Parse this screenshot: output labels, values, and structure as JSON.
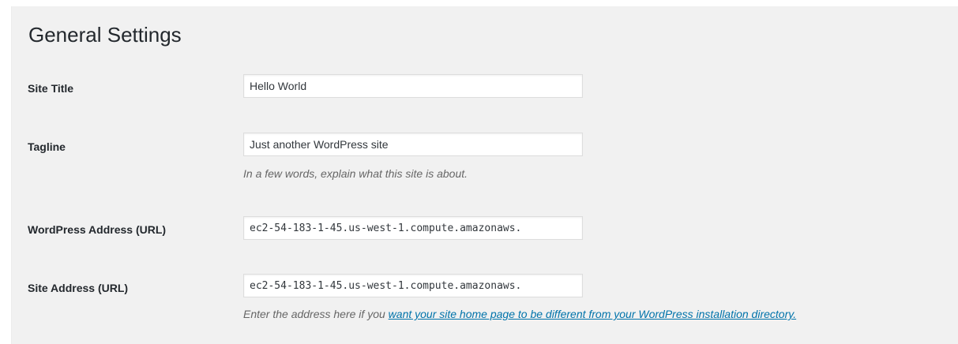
{
  "page": {
    "title": "General Settings"
  },
  "fields": {
    "site_title": {
      "label": "Site Title",
      "value": "Hello World"
    },
    "tagline": {
      "label": "Tagline",
      "value": "Just another WordPress site",
      "description": "In a few words, explain what this site is about."
    },
    "wordpress_address": {
      "label": "WordPress Address (URL)",
      "value": "ec2-54-183-1-45.us-west-1.compute.amazonaws."
    },
    "site_address": {
      "label": "Site Address (URL)",
      "value": "ec2-54-183-1-45.us-west-1.compute.amazonaws.",
      "description_prefix": "Enter the address here if you ",
      "description_link": "want your site home page to be different from your WordPress installation directory."
    }
  },
  "colors": {
    "panel_background": "#f1f1f1",
    "link": "#0073aa",
    "description_text": "#666666",
    "label_text": "#23282d"
  }
}
